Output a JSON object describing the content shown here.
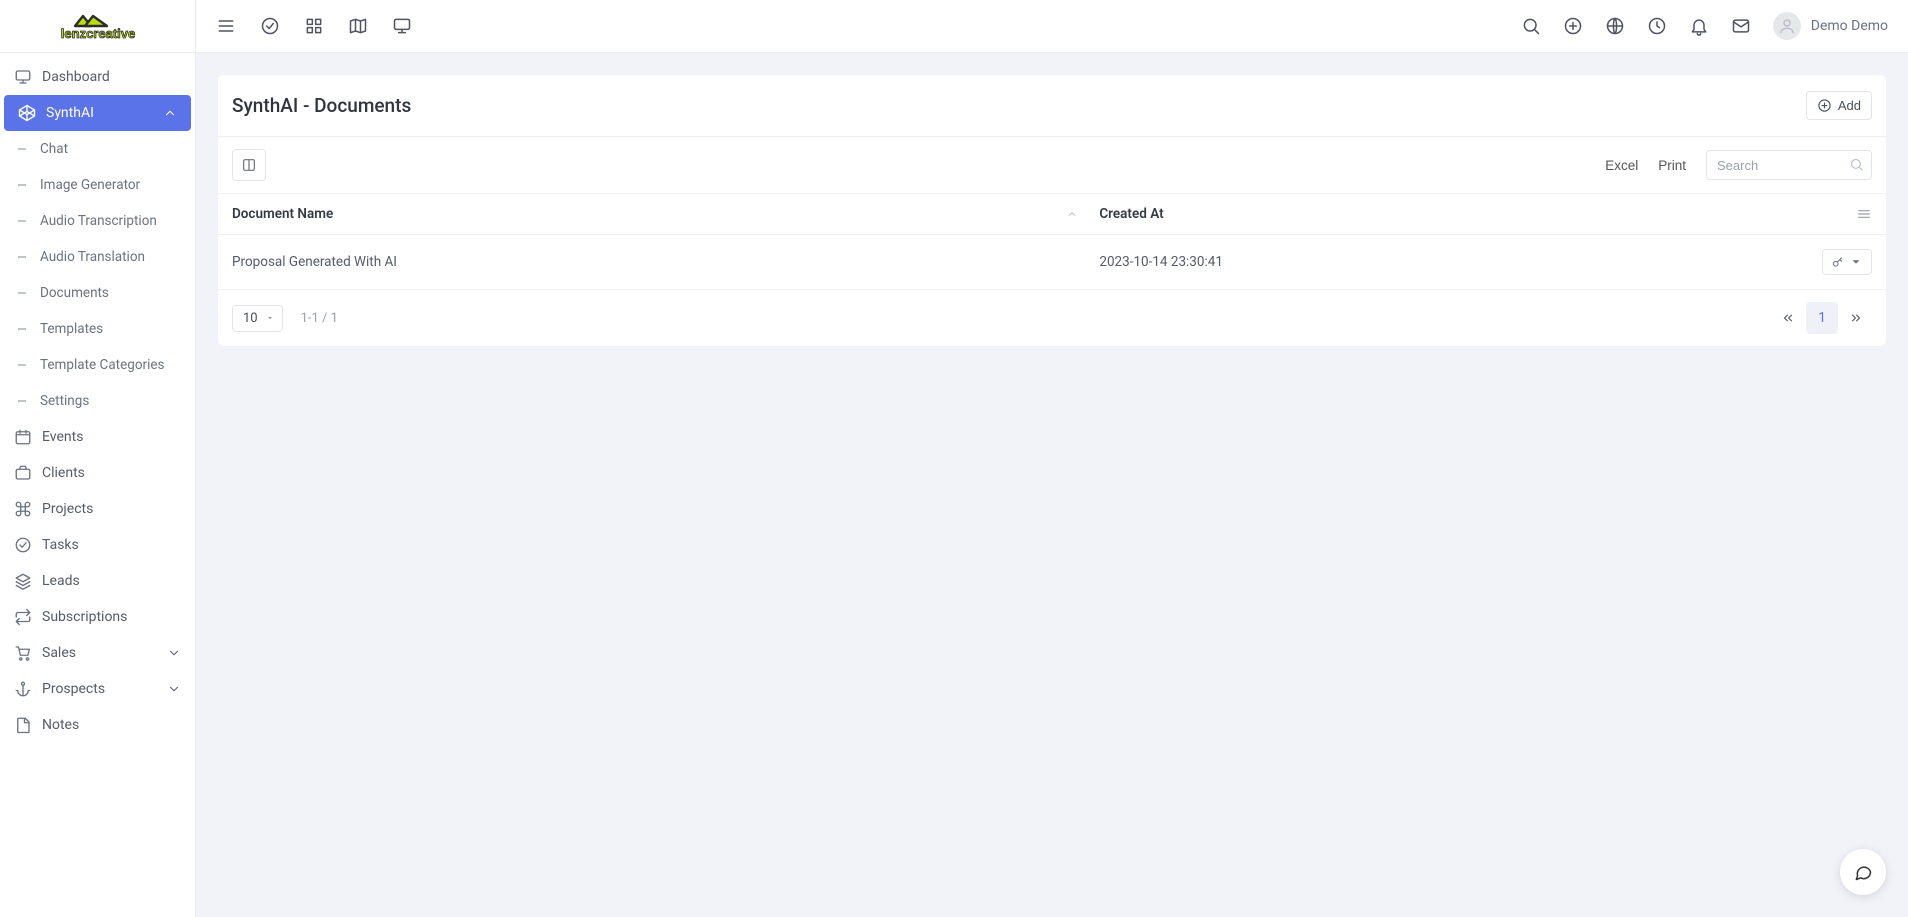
{
  "brand": "lenzcreative",
  "user_name": "Demo Demo",
  "sidebar": {
    "items": [
      {
        "label": "Dashboard",
        "icon": "monitor"
      },
      {
        "label": "SynthAI",
        "icon": "codepen",
        "active": true,
        "expanded": true
      },
      {
        "label": "Events",
        "icon": "calendar"
      },
      {
        "label": "Clients",
        "icon": "briefcase"
      },
      {
        "label": "Projects",
        "icon": "command"
      },
      {
        "label": "Tasks",
        "icon": "check-circle"
      },
      {
        "label": "Leads",
        "icon": "layers"
      },
      {
        "label": "Subscriptions",
        "icon": "repeat"
      },
      {
        "label": "Sales",
        "icon": "cart",
        "chevron": true
      },
      {
        "label": "Prospects",
        "icon": "anchor",
        "chevron": true
      },
      {
        "label": "Notes",
        "icon": "file"
      }
    ],
    "sub_items": [
      "Chat",
      "Image Generator",
      "Audio Transcription",
      "Audio Translation",
      "Documents",
      "Templates",
      "Template Categories",
      "Settings"
    ]
  },
  "page": {
    "title": "SynthAI - Documents",
    "add_label": "Add",
    "export_excel": "Excel",
    "export_print": "Print",
    "search_placeholder": "Search",
    "columns": {
      "name": "Document Name",
      "created": "Created At"
    },
    "rows": [
      {
        "name": "Proposal Generated With AI",
        "created": "2023-10-14 23:30:41"
      }
    ],
    "page_size": "10",
    "page_info": "1-1 / 1",
    "current_page": "1"
  }
}
